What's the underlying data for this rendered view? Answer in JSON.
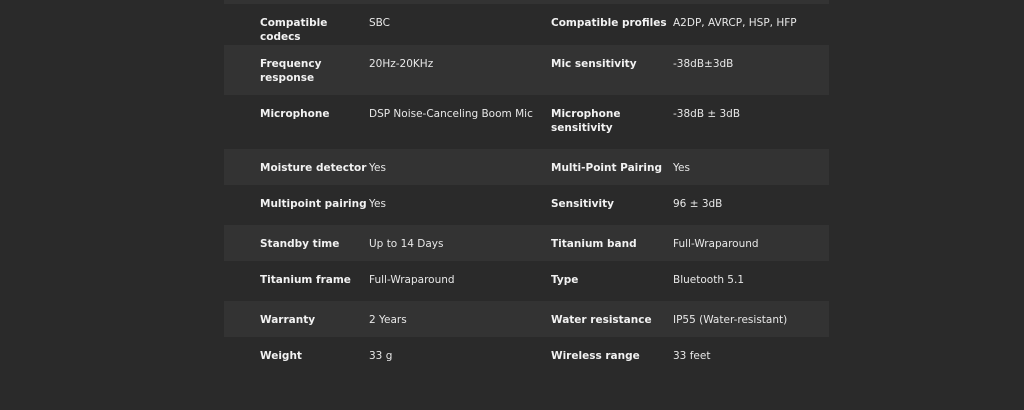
{
  "specs": {
    "rows": [
      {
        "label_a": "Compatible codecs",
        "value_a": "SBC",
        "label_b": "Compatible profiles",
        "value_b": "A2DP, AVRCP, HSP, HFP"
      },
      {
        "label_a": "Frequency response",
        "value_a": "20Hz-20KHz",
        "label_b": "Mic sensitivity",
        "value_b": "-38dB±3dB"
      },
      {
        "label_a": "Microphone",
        "value_a": "DSP Noise-Canceling Boom Mic",
        "label_b": "Microphone sensitivity",
        "value_b": "-38dB ± 3dB"
      },
      {
        "label_a": "Moisture detector",
        "value_a": "Yes",
        "label_b": "Multi-Point Pairing",
        "value_b": "Yes"
      },
      {
        "label_a": "Multipoint pairing",
        "value_a": "Yes",
        "label_b": "Sensitivity",
        "value_b": "96 ± 3dB"
      },
      {
        "label_a": "Standby time",
        "value_a": "Up to 14 Days",
        "label_b": "Titanium band",
        "value_b": "Full-Wraparound"
      },
      {
        "label_a": "Titanium frame",
        "value_a": "Full-Wraparound",
        "label_b": "Type",
        "value_b": "Bluetooth 5.1"
      },
      {
        "label_a": "Warranty",
        "value_a": "2 Years",
        "label_b": "Water resistance",
        "value_b": "IP55 (Water-resistant)"
      },
      {
        "label_a": "Weight",
        "value_a": "33 g",
        "label_b": "Wireless range",
        "value_b": "33 feet"
      }
    ]
  }
}
